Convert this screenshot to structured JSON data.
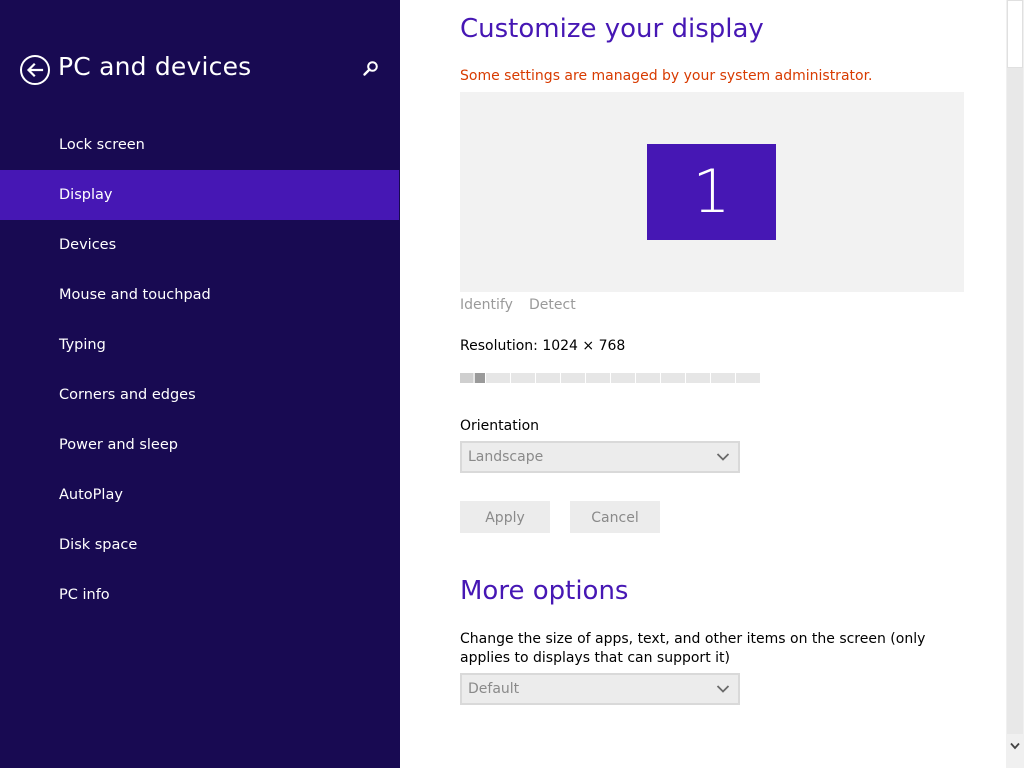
{
  "colors": {
    "sidebar_bg": "#180a52",
    "accent": "#4617b4",
    "warning": "#d83b01"
  },
  "sidebar": {
    "title": "PC and devices",
    "back_icon": "back-arrow-icon",
    "search_icon": "search-icon",
    "items": [
      {
        "label": "Lock screen",
        "active": false
      },
      {
        "label": "Display",
        "active": true
      },
      {
        "label": "Devices",
        "active": false
      },
      {
        "label": "Mouse and touchpad",
        "active": false
      },
      {
        "label": "Typing",
        "active": false
      },
      {
        "label": "Corners and edges",
        "active": false
      },
      {
        "label": "Power and sleep",
        "active": false
      },
      {
        "label": "AutoPlay",
        "active": false
      },
      {
        "label": "Disk space",
        "active": false
      },
      {
        "label": "PC info",
        "active": false
      }
    ]
  },
  "main": {
    "title": "Customize your display",
    "admin_note": "Some settings are managed by your system administrator.",
    "monitor_number": "1",
    "identify_label": "Identify",
    "detect_label": "Detect",
    "resolution_label": "Resolution: 1024 × 768",
    "resolution_slider": {
      "position": 1,
      "steps": 12
    },
    "orientation_label": "Orientation",
    "orientation_value": "Landscape",
    "apply_label": "Apply",
    "cancel_label": "Cancel",
    "more_options_title": "More options",
    "size_description": "Change the size of apps, text, and other items on the screen (only applies to displays that can support it)",
    "size_value": "Default"
  }
}
